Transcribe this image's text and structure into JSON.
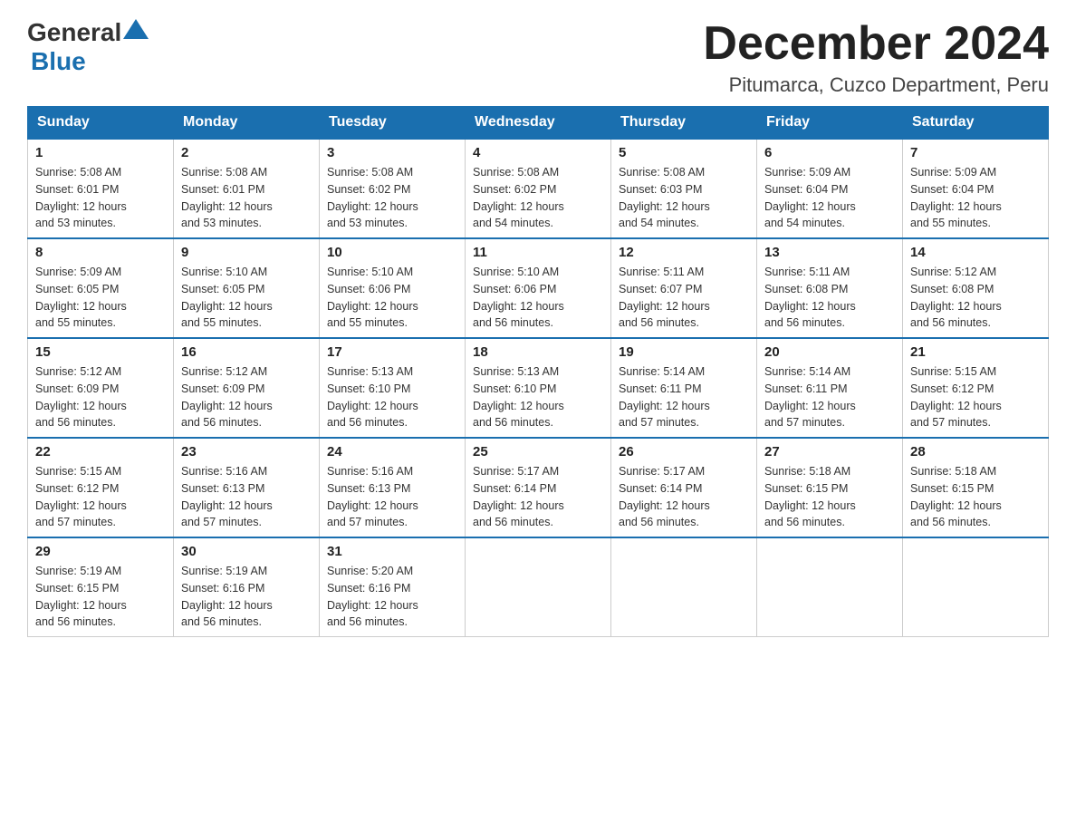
{
  "header": {
    "logo_general": "General",
    "logo_blue": "Blue",
    "main_title": "December 2024",
    "subtitle": "Pitumarca, Cuzco Department, Peru"
  },
  "days_of_week": [
    "Sunday",
    "Monday",
    "Tuesday",
    "Wednesday",
    "Thursday",
    "Friday",
    "Saturday"
  ],
  "weeks": [
    [
      {
        "day": "1",
        "sunrise": "5:08 AM",
        "sunset": "6:01 PM",
        "daylight": "12 hours and 53 minutes."
      },
      {
        "day": "2",
        "sunrise": "5:08 AM",
        "sunset": "6:01 PM",
        "daylight": "12 hours and 53 minutes."
      },
      {
        "day": "3",
        "sunrise": "5:08 AM",
        "sunset": "6:02 PM",
        "daylight": "12 hours and 53 minutes."
      },
      {
        "day": "4",
        "sunrise": "5:08 AM",
        "sunset": "6:02 PM",
        "daylight": "12 hours and 54 minutes."
      },
      {
        "day": "5",
        "sunrise": "5:08 AM",
        "sunset": "6:03 PM",
        "daylight": "12 hours and 54 minutes."
      },
      {
        "day": "6",
        "sunrise": "5:09 AM",
        "sunset": "6:04 PM",
        "daylight": "12 hours and 54 minutes."
      },
      {
        "day": "7",
        "sunrise": "5:09 AM",
        "sunset": "6:04 PM",
        "daylight": "12 hours and 55 minutes."
      }
    ],
    [
      {
        "day": "8",
        "sunrise": "5:09 AM",
        "sunset": "6:05 PM",
        "daylight": "12 hours and 55 minutes."
      },
      {
        "day": "9",
        "sunrise": "5:10 AM",
        "sunset": "6:05 PM",
        "daylight": "12 hours and 55 minutes."
      },
      {
        "day": "10",
        "sunrise": "5:10 AM",
        "sunset": "6:06 PM",
        "daylight": "12 hours and 55 minutes."
      },
      {
        "day": "11",
        "sunrise": "5:10 AM",
        "sunset": "6:06 PM",
        "daylight": "12 hours and 56 minutes."
      },
      {
        "day": "12",
        "sunrise": "5:11 AM",
        "sunset": "6:07 PM",
        "daylight": "12 hours and 56 minutes."
      },
      {
        "day": "13",
        "sunrise": "5:11 AM",
        "sunset": "6:08 PM",
        "daylight": "12 hours and 56 minutes."
      },
      {
        "day": "14",
        "sunrise": "5:12 AM",
        "sunset": "6:08 PM",
        "daylight": "12 hours and 56 minutes."
      }
    ],
    [
      {
        "day": "15",
        "sunrise": "5:12 AM",
        "sunset": "6:09 PM",
        "daylight": "12 hours and 56 minutes."
      },
      {
        "day": "16",
        "sunrise": "5:12 AM",
        "sunset": "6:09 PM",
        "daylight": "12 hours and 56 minutes."
      },
      {
        "day": "17",
        "sunrise": "5:13 AM",
        "sunset": "6:10 PM",
        "daylight": "12 hours and 56 minutes."
      },
      {
        "day": "18",
        "sunrise": "5:13 AM",
        "sunset": "6:10 PM",
        "daylight": "12 hours and 56 minutes."
      },
      {
        "day": "19",
        "sunrise": "5:14 AM",
        "sunset": "6:11 PM",
        "daylight": "12 hours and 57 minutes."
      },
      {
        "day": "20",
        "sunrise": "5:14 AM",
        "sunset": "6:11 PM",
        "daylight": "12 hours and 57 minutes."
      },
      {
        "day": "21",
        "sunrise": "5:15 AM",
        "sunset": "6:12 PM",
        "daylight": "12 hours and 57 minutes."
      }
    ],
    [
      {
        "day": "22",
        "sunrise": "5:15 AM",
        "sunset": "6:12 PM",
        "daylight": "12 hours and 57 minutes."
      },
      {
        "day": "23",
        "sunrise": "5:16 AM",
        "sunset": "6:13 PM",
        "daylight": "12 hours and 57 minutes."
      },
      {
        "day": "24",
        "sunrise": "5:16 AM",
        "sunset": "6:13 PM",
        "daylight": "12 hours and 57 minutes."
      },
      {
        "day": "25",
        "sunrise": "5:17 AM",
        "sunset": "6:14 PM",
        "daylight": "12 hours and 56 minutes."
      },
      {
        "day": "26",
        "sunrise": "5:17 AM",
        "sunset": "6:14 PM",
        "daylight": "12 hours and 56 minutes."
      },
      {
        "day": "27",
        "sunrise": "5:18 AM",
        "sunset": "6:15 PM",
        "daylight": "12 hours and 56 minutes."
      },
      {
        "day": "28",
        "sunrise": "5:18 AM",
        "sunset": "6:15 PM",
        "daylight": "12 hours and 56 minutes."
      }
    ],
    [
      {
        "day": "29",
        "sunrise": "5:19 AM",
        "sunset": "6:15 PM",
        "daylight": "12 hours and 56 minutes."
      },
      {
        "day": "30",
        "sunrise": "5:19 AM",
        "sunset": "6:16 PM",
        "daylight": "12 hours and 56 minutes."
      },
      {
        "day": "31",
        "sunrise": "5:20 AM",
        "sunset": "6:16 PM",
        "daylight": "12 hours and 56 minutes."
      },
      null,
      null,
      null,
      null
    ]
  ],
  "labels": {
    "sunrise": "Sunrise:",
    "sunset": "Sunset:",
    "daylight": "Daylight:"
  }
}
